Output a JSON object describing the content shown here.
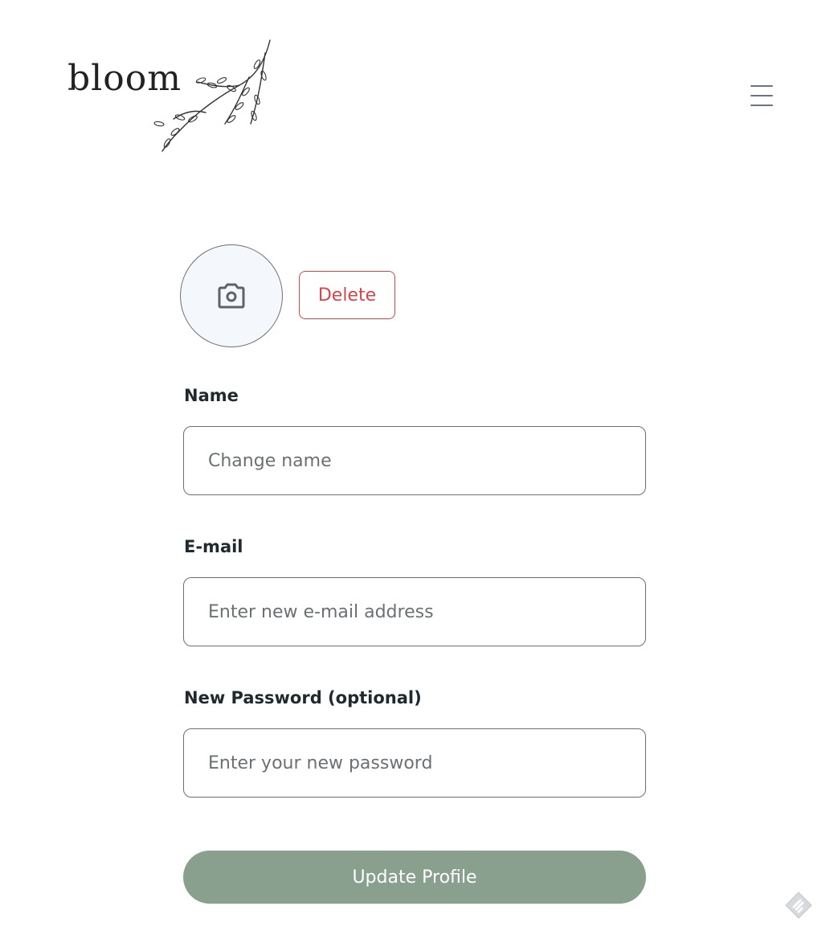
{
  "header": {
    "logo_text": "bloom",
    "menu_icon": "hamburger-menu-icon"
  },
  "avatar": {
    "icon": "camera-icon",
    "delete_label": "Delete"
  },
  "form": {
    "name": {
      "label": "Name",
      "placeholder": "Change name",
      "value": ""
    },
    "email": {
      "label": "E-mail",
      "placeholder": "Enter new e-mail address",
      "value": ""
    },
    "password": {
      "label": "New Password (optional)",
      "placeholder": "Enter your new password",
      "value": ""
    },
    "submit_label": "Update Profile"
  },
  "colors": {
    "accent": "#8aa08e",
    "danger": "#d9434b",
    "text": "#1f2a2e",
    "avatar_bg": "#f4f8fc"
  },
  "corner_badge_icon": "feedback-badge-icon"
}
